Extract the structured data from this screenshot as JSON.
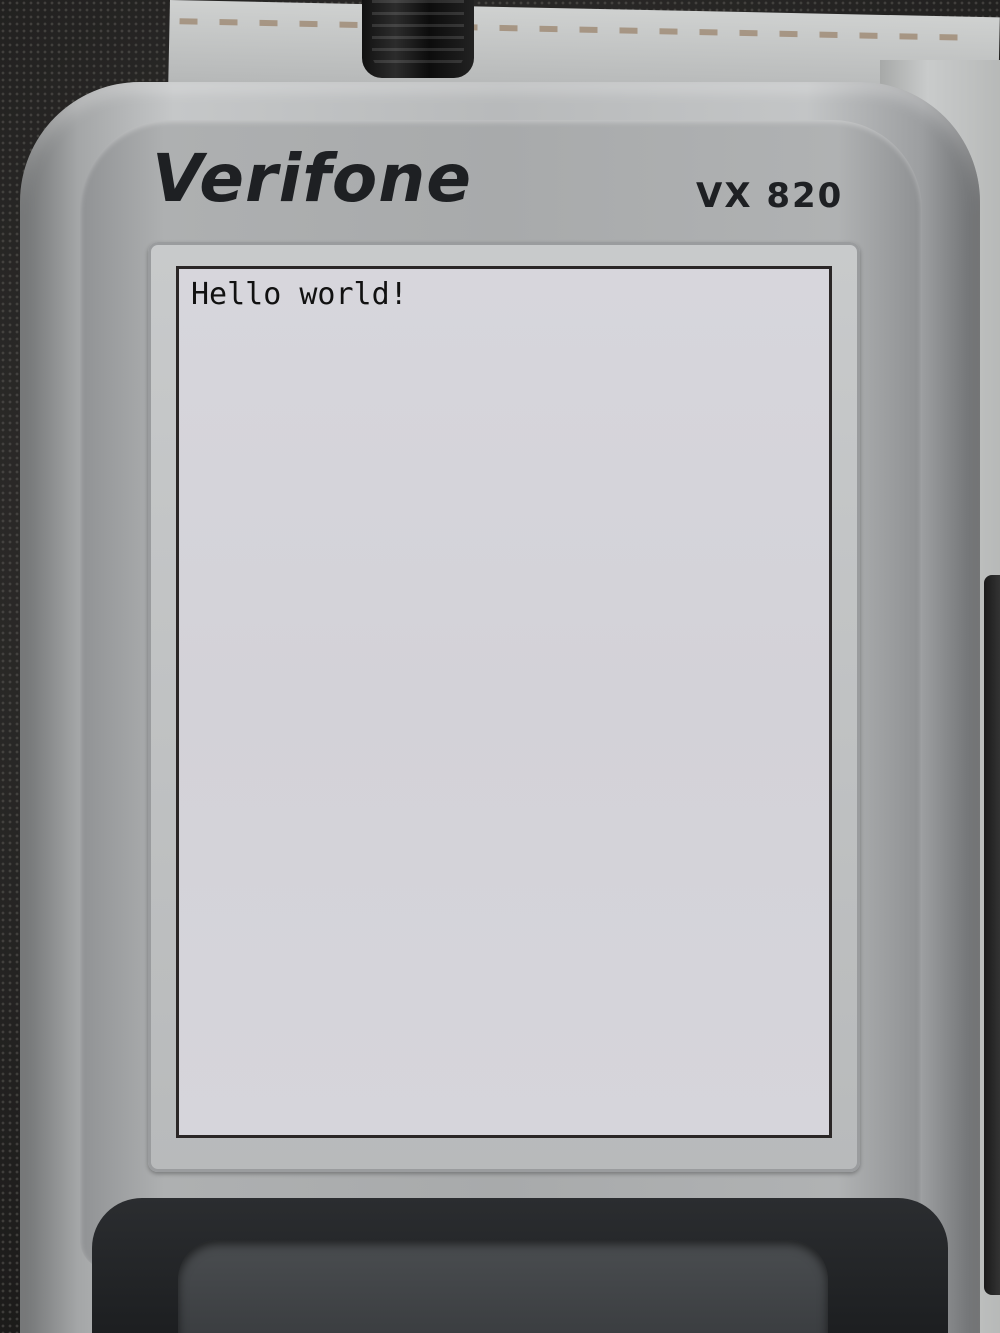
{
  "device": {
    "brand": "Verifone",
    "model": "VX 820"
  },
  "screen": {
    "text": "Hello world!"
  },
  "colors": {
    "body": "#b8babb",
    "screen": "#d5d4da",
    "text": "#111111",
    "background": "#2b2a29"
  }
}
